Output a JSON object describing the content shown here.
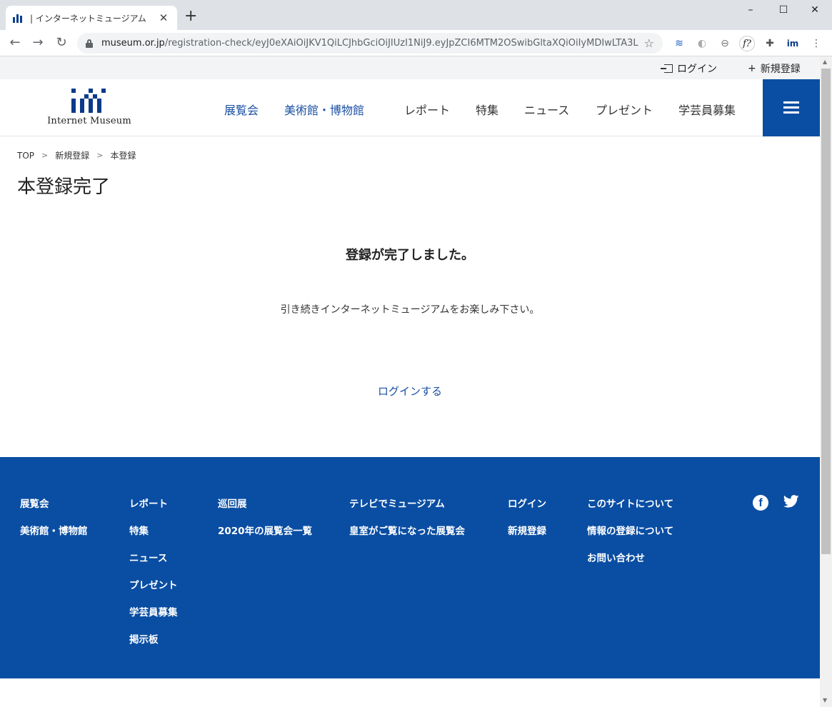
{
  "browser": {
    "tab_title": "| インターネットミュージアム",
    "tab_close": "✕",
    "new_tab": "+",
    "url_host": "museum.or.jp",
    "url_path": "/registration-check/eyJ0eXAiOiJKV1QiLCJhbGciOiJIUzI1NiJ9.eyJpZCI6MTM2OSwibGltaXQiOiIyMDIwLTA3L...",
    "window_controls": [
      "–",
      "☐",
      "✕"
    ],
    "extension_f_label": "f?",
    "extension_im_label": "im"
  },
  "topbar": {
    "login_label": "ログイン",
    "register_label": "新規登録",
    "register_prefix": "+"
  },
  "header": {
    "logo_text": "Internet Museum",
    "nav": [
      "展覧会",
      "美術館・博物館",
      "レポート",
      "特集",
      "ニュース",
      "プレゼント",
      "学芸員募集"
    ]
  },
  "breadcrumb": [
    "TOP",
    "新規登録",
    "本登録"
  ],
  "breadcrumb_sep": ">",
  "main": {
    "title": "本登録完了",
    "complete_message": "登録が完了しました。",
    "sub_message": "引き続きインターネットミュージアムをお楽しみ下さい。",
    "login_link": "ログインする"
  },
  "footer": {
    "col1": [
      "展覧会",
      "美術館・博物館"
    ],
    "col2": [
      "レポート",
      "特集",
      "ニュース",
      "プレゼント",
      "学芸員募集",
      "掲示板"
    ],
    "col3": [
      "巡回展",
      "2020年の展覧会一覧"
    ],
    "col4": [
      "テレビでミュージアム",
      "皇室がご覧になった展覧会"
    ],
    "col5": [
      "ログイン",
      "新規登録"
    ],
    "col6": [
      "このサイトについて",
      "情報の登録について",
      "お問い合わせ"
    ],
    "facebook_glyph": "f"
  },
  "colors": {
    "brand_blue": "#0a4ea3",
    "link_blue": "#1a4fa3"
  }
}
